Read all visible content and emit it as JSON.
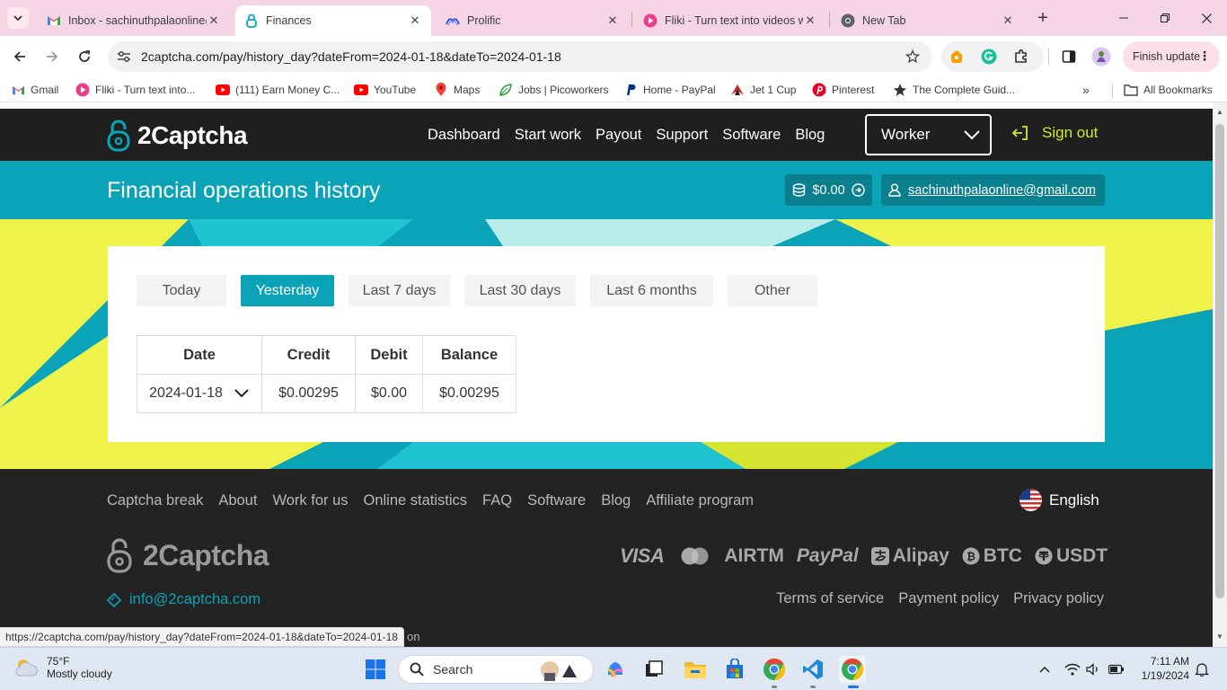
{
  "browser": {
    "tabs": [
      {
        "title": "Inbox - sachinuthpalaonline@",
        "icon": "gmail-icon",
        "active": false
      },
      {
        "title": "Finances",
        "icon": "2captcha-icon",
        "active": true
      },
      {
        "title": "Prolific",
        "icon": "prolific-icon",
        "active": false
      },
      {
        "title": "Fliki - Turn text into videos w",
        "icon": "fliki-icon",
        "active": false
      },
      {
        "title": "New Tab",
        "icon": "chrome-icon",
        "active": false
      }
    ],
    "url": "2captcha.com/pay/history_day?dateFrom=2024-01-18&dateTo=2024-01-18",
    "finish_update": "Finish update",
    "bookmarks": [
      "Gmail",
      "Fliki - Turn text into...",
      "(111) Earn Money C...",
      "YouTube",
      "Maps",
      "Jobs | Picoworkers",
      "Home - PayPal",
      "Jet 1 Cup",
      "Pinterest",
      "The Complete Guid..."
    ],
    "all_bookmarks": "All Bookmarks",
    "more_bookmarks": "»",
    "status_url": "https://2captcha.com/pay/history_day?dateFrom=2024-01-18&dateTo=2024-01-18"
  },
  "site": {
    "logo": "2Captcha",
    "nav": [
      "Dashboard",
      "Start work",
      "Payout",
      "Support",
      "Software",
      "Blog"
    ],
    "role_select": "Worker",
    "sign_out": "Sign out",
    "page_title": "Financial operations history",
    "balance": "$0.00",
    "user_email": "sachinuthpalaonline@gmail.com",
    "filters": [
      "Today",
      "Yesterday",
      "Last 7 days",
      "Last 30 days",
      "Last 6 months",
      "Other"
    ],
    "active_filter": "Yesterday",
    "table": {
      "headers": [
        "Date",
        "Credit",
        "Debit",
        "Balance"
      ],
      "rows": [
        {
          "date": "2024-01-18",
          "credit": "$0.00295",
          "debit": "$0.00",
          "balance": "$0.00295"
        }
      ]
    },
    "colors": {
      "accent": "#0ba3b8",
      "accent_dark": "#0a7f8d",
      "header_bg": "#1f1f1f",
      "yellow": "#eef24a",
      "sign_out": "#d7e82b"
    }
  },
  "footer": {
    "links": [
      "Captcha break",
      "About",
      "Work for us",
      "Online statistics",
      "FAQ",
      "Software",
      "Blog",
      "Affiliate program"
    ],
    "language": "English",
    "logo": "2Captcha",
    "payment_methods": [
      "VISA",
      "AIRTM",
      "PayPal",
      "Alipay",
      "BTC",
      "USDT"
    ],
    "email": "info@2captcha.com",
    "legal": [
      "Terms of service",
      "Payment policy",
      "Privacy policy"
    ],
    "tail_text": "on"
  },
  "taskbar": {
    "weather_temp": "75°F",
    "weather_desc": "Mostly cloudy",
    "search_placeholder": "Search",
    "time": "7:11 AM",
    "date": "1/19/2024"
  }
}
